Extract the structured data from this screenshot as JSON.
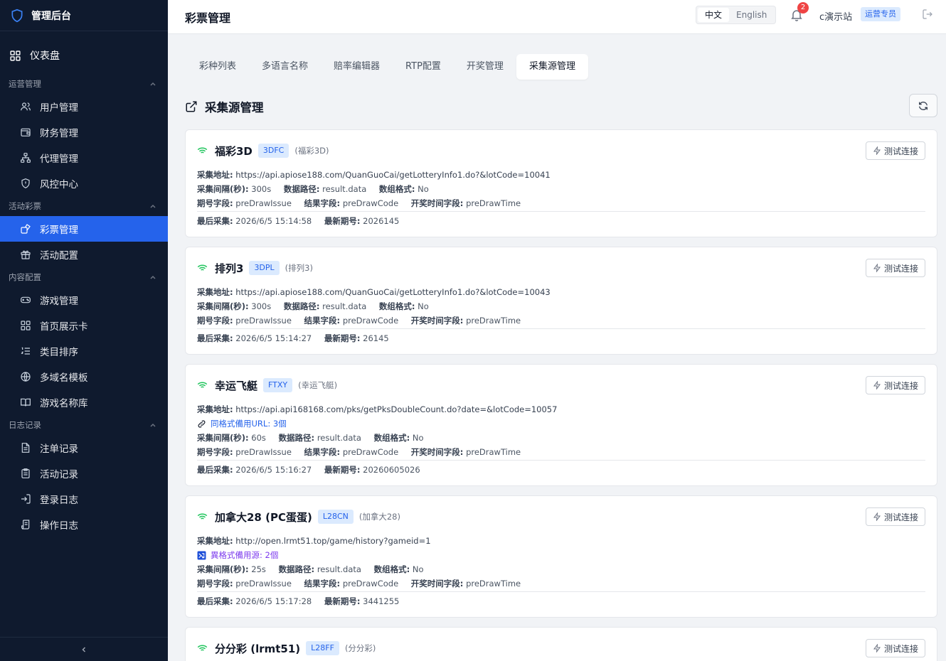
{
  "brand": {
    "name": "管理后台"
  },
  "sidebar": {
    "dashboard": "仪表盘",
    "groups": [
      {
        "title": "运营管理",
        "items": [
          "用户管理",
          "财务管理",
          "代理管理",
          "风控中心"
        ]
      },
      {
        "title": "活动彩票",
        "items": [
          "彩票管理",
          "活动配置"
        ]
      },
      {
        "title": "内容配置",
        "items": [
          "游戏管理",
          "首页展示卡",
          "类目排序",
          "多域名模板",
          "游戏名称库"
        ]
      },
      {
        "title": "日志记录",
        "items": [
          "注单记录",
          "活动记录",
          "登录日志",
          "操作日志"
        ]
      }
    ],
    "active_item": "彩票管理"
  },
  "header": {
    "title": "彩票管理",
    "lang_options": [
      "中文",
      "English"
    ],
    "lang_selected": "中文",
    "notification_count": "2",
    "user_name": "c演示站",
    "user_role": "运营专员"
  },
  "tabs": [
    "彩种列表",
    "多语言名称",
    "赔率编辑器",
    "RTP配置",
    "开奖管理",
    "采集源管理"
  ],
  "active_tab": "采集源管理",
  "section_title": "采集源管理",
  "labels": {
    "test_button": "测试连接",
    "url": "采集地址:",
    "interval": "采集间隔(秒):",
    "data_path": "数据路径:",
    "array_format": "数组格式:",
    "issue_field": "期号字段:",
    "result_field": "结果字段:",
    "time_field": "开奖时间字段:",
    "last_collect": "最后采集:",
    "latest_issue": "最新期号:"
  },
  "sources": [
    {
      "name": "福彩3D",
      "code": "3DFC",
      "alias": "(福彩3D)",
      "url": "https://api.apiose188.com/QuanGuoCai/getLotteryInfo1.do?&lotCode=10041",
      "backup": "",
      "interval": "300s",
      "data_path": "result.data",
      "array_format": "No",
      "issue_field": "preDrawIssue",
      "result_field": "preDrawCode",
      "time_field": "preDrawTime",
      "last_collect": "2026/6/5 15:14:58",
      "latest_issue": "2026145"
    },
    {
      "name": "排列3",
      "code": "3DPL",
      "alias": "(排列3)",
      "url": "https://api.apiose188.com/QuanGuoCai/getLotteryInfo1.do?&lotCode=10043",
      "backup": "",
      "interval": "300s",
      "data_path": "result.data",
      "array_format": "No",
      "issue_field": "preDrawIssue",
      "result_field": "preDrawCode",
      "time_field": "preDrawTime",
      "last_collect": "2026/6/5 15:14:27",
      "latest_issue": "26145"
    },
    {
      "name": "幸运飞艇",
      "code": "FTXY",
      "alias": "(幸运飞艇)",
      "url": "https://api.api168168.com/pks/getPksDoubleCount.do?date=&lotCode=10057",
      "backup": "同格式備用URL: 3個",
      "backup_type": "same",
      "interval": "60s",
      "data_path": "result.data",
      "array_format": "No",
      "issue_field": "preDrawIssue",
      "result_field": "preDrawCode",
      "time_field": "preDrawTime",
      "last_collect": "2026/6/5 15:16:27",
      "latest_issue": "20260605026"
    },
    {
      "name": "加拿大28 (PC蛋蛋)",
      "code": "L28CN",
      "alias": "(加拿大28)",
      "url": "http://open.lrmt51.top/game/history?gameid=1",
      "backup": "異格式備用源: 2個",
      "backup_type": "diff",
      "interval": "25s",
      "data_path": "result.data",
      "array_format": "No",
      "issue_field": "preDrawIssue",
      "result_field": "preDrawCode",
      "time_field": "preDrawTime",
      "last_collect": "2026/6/5 15:17:28",
      "latest_issue": "3441255"
    },
    {
      "name": "分分彩 (lrmt51)",
      "code": "L28FF",
      "alias": "(分分彩)"
    }
  ],
  "colors": {
    "sidebar_bg": "#0f1a2e",
    "accent": "#2563eb",
    "status_ok": "#22c55e"
  }
}
